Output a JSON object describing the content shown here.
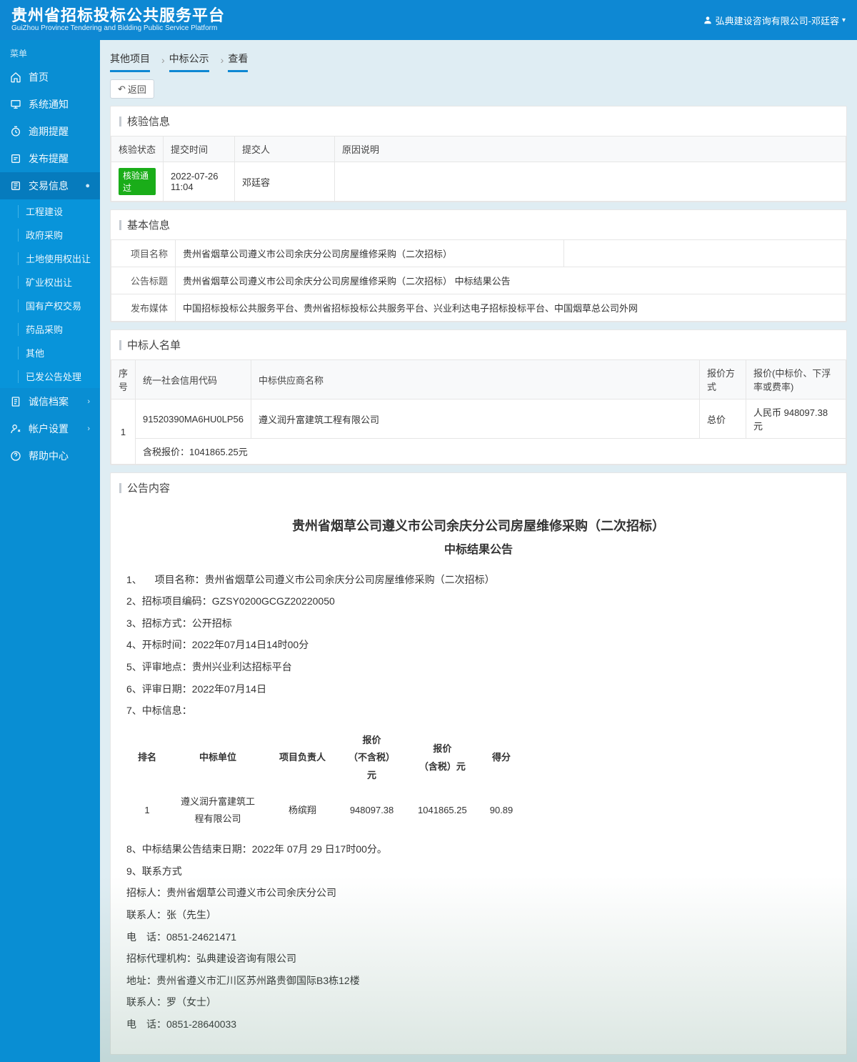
{
  "header": {
    "title": "贵州省招标投标公共服务平台",
    "subtitle": "GuiZhou Province Tendering and Bidding Public Service Platform",
    "user": "弘典建设咨询有限公司-邓廷容"
  },
  "sidebar": {
    "label": "菜单",
    "items": [
      {
        "label": "首页",
        "icon": "home"
      },
      {
        "label": "系统通知",
        "icon": "monitor"
      },
      {
        "label": "逾期提醒",
        "icon": "due"
      },
      {
        "label": "发布提醒",
        "icon": "publish"
      },
      {
        "label": "交易信息",
        "icon": "trade",
        "active": true
      },
      {
        "label": "诚信档案",
        "icon": "file"
      },
      {
        "label": "帐户设置",
        "icon": "user"
      },
      {
        "label": "帮助中心",
        "icon": "help"
      }
    ],
    "sub": [
      {
        "label": "工程建设"
      },
      {
        "label": "政府采购"
      },
      {
        "label": "土地使用权出让"
      },
      {
        "label": "矿业权出让"
      },
      {
        "label": "国有产权交易"
      },
      {
        "label": "药品采购"
      },
      {
        "label": "其他"
      },
      {
        "label": "已发公告处理"
      }
    ]
  },
  "breadcrumb": [
    "其他项目",
    "中标公示",
    "查看"
  ],
  "back_button": "返回",
  "panels": {
    "verify": {
      "title": "核验信息",
      "headers": [
        "核验状态",
        "提交时间",
        "提交人",
        "原因说明"
      ],
      "badge": "核验通过",
      "time": "2022-07-26 11:04",
      "submitter": "邓廷容",
      "reason": ""
    },
    "basic": {
      "title": "基本信息",
      "rows": [
        {
          "label": "项目名称",
          "value": "贵州省烟草公司遵义市公司余庆分公司房屋维修采购（二次招标）"
        },
        {
          "label": "公告标题",
          "value": "贵州省烟草公司遵义市公司余庆分公司房屋维修采购（二次招标） 中标结果公告"
        },
        {
          "label": "发布媒体",
          "value": "中国招标投标公共服务平台、贵州省招标投标公共服务平台、兴业利达电子招标投标平台、中国烟草总公司外网"
        }
      ]
    },
    "winners": {
      "title": "中标人名单",
      "headers": [
        "序号",
        "统一社会信用代码",
        "中标供应商名称",
        "报价方式",
        "报价(中标价、下浮率或费率)"
      ],
      "row": {
        "idx": "1",
        "code": "91520390MA6HU0LP56",
        "name": "遵义润升富建筑工程有限公司",
        "method": "总价",
        "price": "人民币 948097.38 元",
        "tax": "含税报价：1041865.25元"
      }
    },
    "content": {
      "title": "公告内容",
      "heading": "贵州省烟草公司遵义市公司余庆分公司房屋维修采购（二次招标）",
      "subheading": "中标结果公告",
      "items": [
        "1、 　项目名称：贵州省烟草公司遵义市公司余庆分公司房屋维修采购（二次招标）",
        "2、招标项目编码：GZSY0200GCGZ20220050",
        "3、招标方式：公开招标",
        "4、开标时间：2022年07月14日14时00分",
        "5、评审地点：贵州兴业利达招标平台",
        "6、评审日期：2022年07月14日",
        "7、中标信息："
      ],
      "rank_headers": [
        "排名",
        "中标单位",
        "项目负责人",
        "报价\n（不含税）\n元",
        "报价\n（含税）元",
        "得分"
      ],
      "rank_row": [
        "1",
        "遵义润升富建筑工程有限公司",
        "杨缤翔",
        "948097.38",
        "1041865.25",
        "90.89"
      ],
      "after": [
        "8、中标结果公告结束日期：2022年 07月 29 日17时00分。",
        "9、联系方式",
        "招标人：贵州省烟草公司遵义市公司余庆分公司",
        "联系人：张（先生）",
        "电　话：0851-24621471",
        "招标代理机构：弘典建设咨询有限公司",
        "地址：贵州省遵义市汇川区苏州路贵御国际B3栋12楼",
        "联系人：罗（女士）",
        "电　话：0851-28640033"
      ]
    }
  }
}
